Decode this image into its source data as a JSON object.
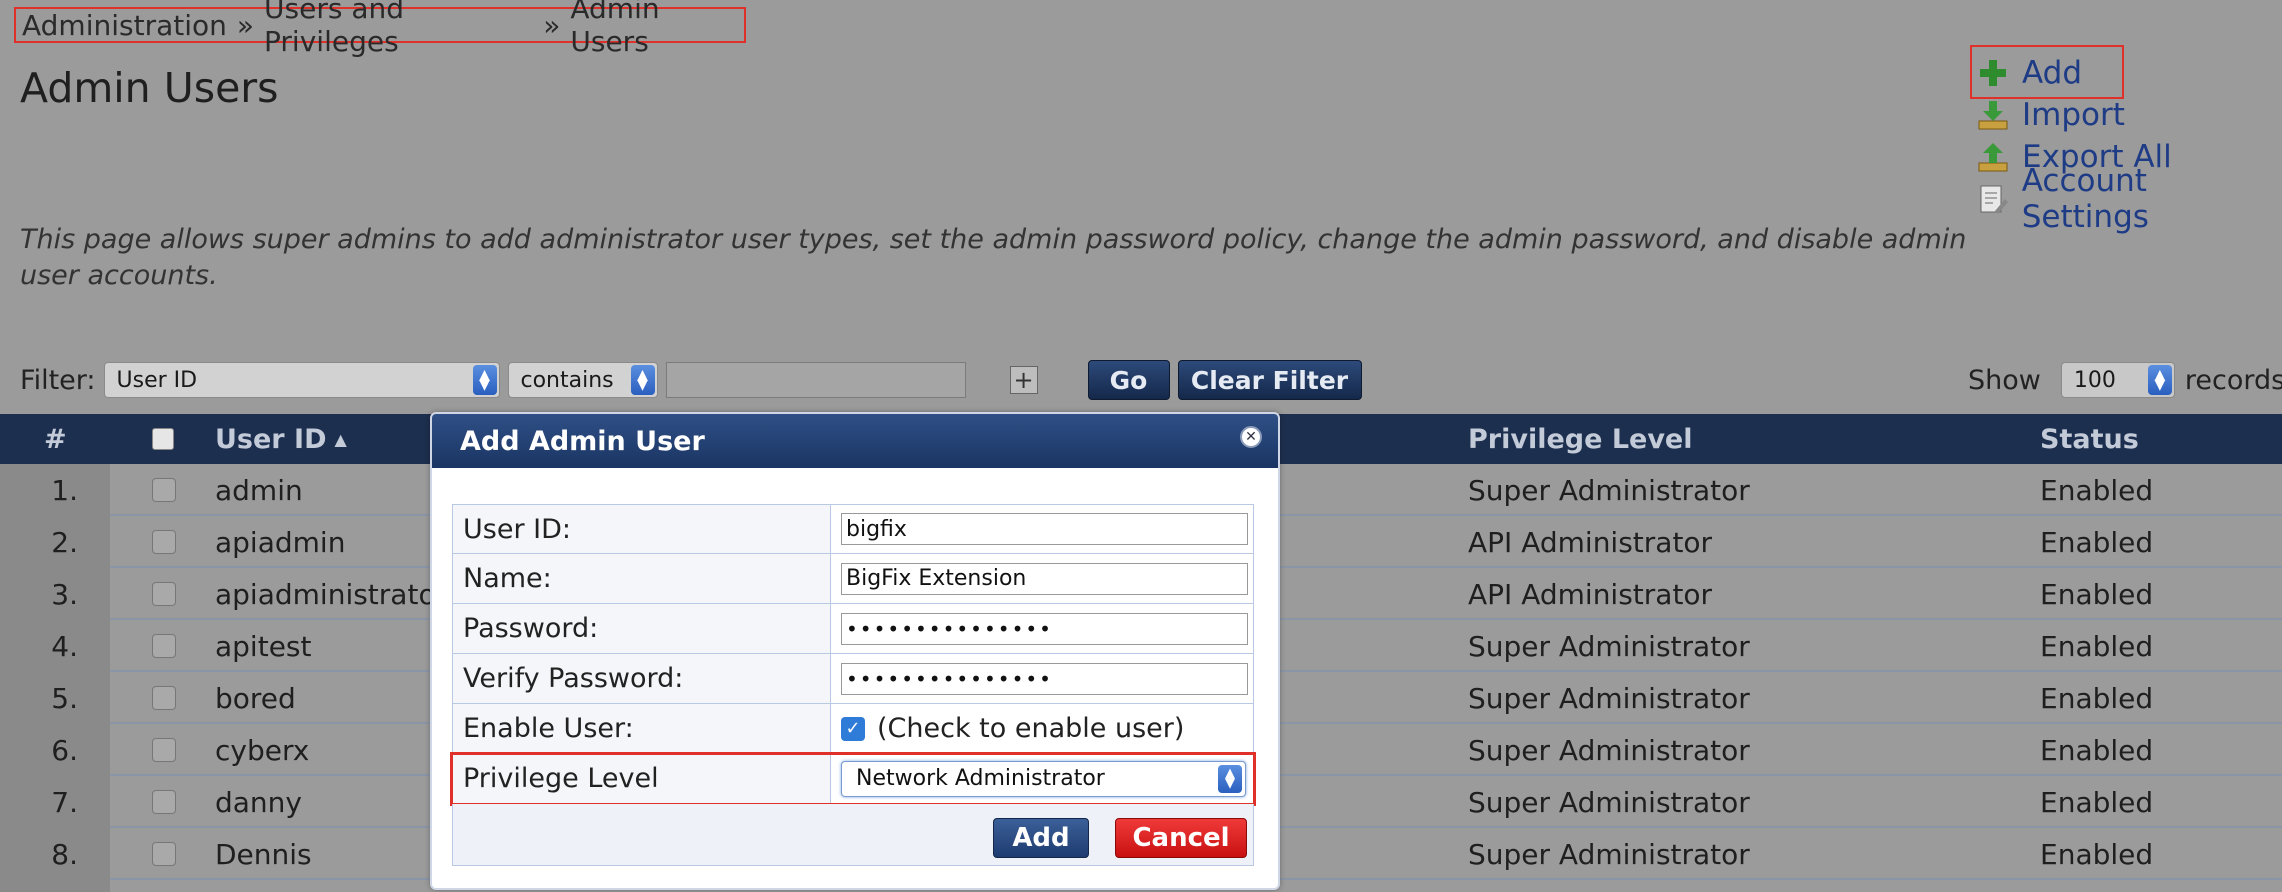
{
  "breadcrumb": {
    "items": [
      "Administration",
      "Users and Privileges",
      "Admin Users"
    ],
    "separator": "»"
  },
  "page": {
    "title": "Admin Users",
    "description": "This page allows super admins to add administrator user types, set the admin password policy, change the admin password, and disable admin user accounts."
  },
  "actions": [
    {
      "label": "Add",
      "icon": "plus-icon"
    },
    {
      "label": "Import",
      "icon": "import-icon"
    },
    {
      "label": "Export All",
      "icon": "export-icon"
    },
    {
      "label": "Account Settings",
      "icon": "settings-icon"
    }
  ],
  "filter": {
    "label": "Filter:",
    "field": "User ID",
    "operator": "contains",
    "value": "",
    "go_label": "Go",
    "clear_label": "Clear Filter",
    "show_label": "Show",
    "show_value": "100",
    "records_label": "records"
  },
  "table": {
    "columns": {
      "num": "#",
      "user_id": "User ID",
      "sort_indicator": "▲",
      "privilege": "Privilege Level",
      "status": "Status"
    },
    "rows": [
      {
        "num": "1.",
        "user_id": "admin",
        "privilege": "Super Administrator",
        "status": "Enabled"
      },
      {
        "num": "2.",
        "user_id": "apiadmin",
        "privilege": "API Administrator",
        "status": "Enabled"
      },
      {
        "num": "3.",
        "user_id": "apiadministrator",
        "privilege": "API Administrator",
        "status": "Enabled"
      },
      {
        "num": "4.",
        "user_id": "apitest",
        "privilege": "Super Administrator",
        "status": "Enabled"
      },
      {
        "num": "5.",
        "user_id": "bored",
        "privilege": "Super Administrator",
        "status": "Enabled"
      },
      {
        "num": "6.",
        "user_id": "cyberx",
        "privilege": "Super Administrator",
        "status": "Enabled"
      },
      {
        "num": "7.",
        "user_id": "danny",
        "privilege": "Super Administrator",
        "status": "Enabled"
      },
      {
        "num": "8.",
        "user_id": "Dennis",
        "privilege": "Super Administrator",
        "status": "Enabled"
      }
    ]
  },
  "modal": {
    "title": "Add Admin User",
    "fields": {
      "user_id_label": "User ID:",
      "user_id_value": "bigfix",
      "name_label": "Name:",
      "name_value": "BigFix Extension",
      "password_label": "Password:",
      "password_value": "•••••••••••••••",
      "verify_label": "Verify Password:",
      "verify_value": "•••••••••••••••",
      "enable_label": "Enable User:",
      "enable_text": "(Check to enable user)",
      "enable_checked": true,
      "privilege_label": "Privilege Level",
      "privilege_value": "Network Administrator"
    },
    "add_label": "Add",
    "cancel_label": "Cancel"
  },
  "colors": {
    "highlight": "#e0302a",
    "header_bg": "#1d2f4f",
    "link": "#1e3b86",
    "cancel": "#d81818"
  }
}
